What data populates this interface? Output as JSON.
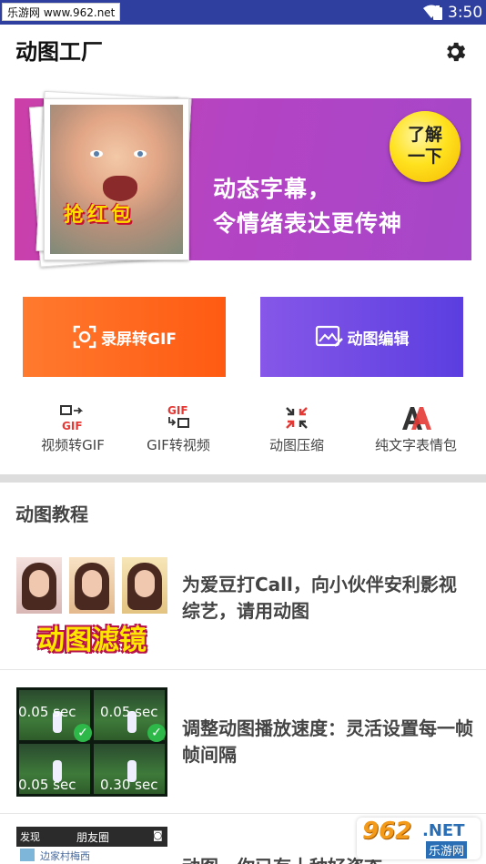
{
  "status_bar": {
    "site_label": "乐游网 www.962.net",
    "time": "3:50"
  },
  "app_bar": {
    "title": "动图工厂",
    "settings_icon": "gear-icon"
  },
  "banner": {
    "photo_caption": "抢红包",
    "line1": "动态字幕，",
    "line2": "令情绪表达更传神",
    "badge_line1": "了解",
    "badge_line2": "一下"
  },
  "primary_actions": [
    {
      "label": "录屏转GIF",
      "icon": "screen-record-icon",
      "color": "#ff6a1f"
    },
    {
      "label": "动图编辑",
      "icon": "image-edit-icon",
      "color": "#6e48e6"
    }
  ],
  "tools": [
    {
      "label": "视频转GIF",
      "icon": "video-to-gif-icon"
    },
    {
      "label": "GIF转视频",
      "icon": "gif-to-video-icon"
    },
    {
      "label": "动图压缩",
      "icon": "compress-icon"
    },
    {
      "label": "纯文字表情包",
      "icon": "text-sticker-icon"
    }
  ],
  "tutorials": {
    "title": "动图教程",
    "items": [
      {
        "thumb_caption": "动图滤镜",
        "text": "为爱豆打Call，向小伙伴安利影视综艺，请用动图"
      },
      {
        "thumb_labels": [
          "0.05 sec",
          "0.05 sec",
          "0.05 sec",
          "0.30 sec"
        ],
        "text": "调整动图播放速度：灵活设置每一帧帧间隔"
      },
      {
        "thumb_back": "发现",
        "thumb_title": "朋友圈",
        "thumb_name": "边家村梅西",
        "text": "动图，你已有十种好姿态"
      }
    ]
  },
  "watermark": {
    "brand": "962",
    "suffix": ".NET",
    "tag": "乐游网"
  },
  "colors": {
    "status_bar": "#2f3fa0",
    "accent_orange": "#ff6a1f",
    "accent_purple": "#6e48e6",
    "tool_red": "#e53935"
  }
}
